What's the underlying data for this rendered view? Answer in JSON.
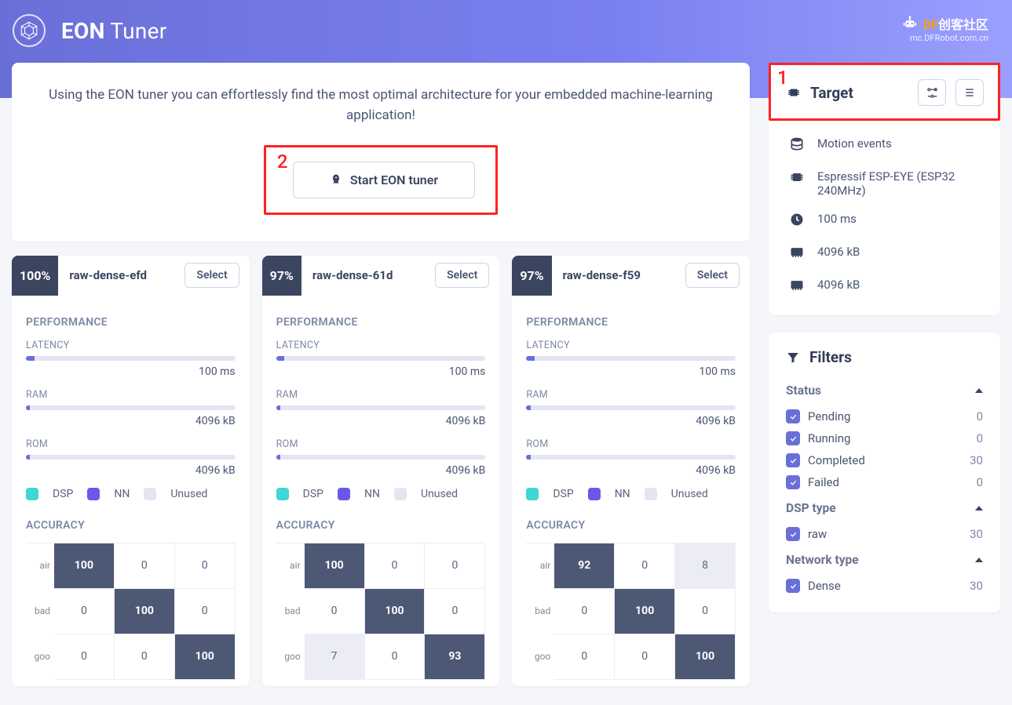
{
  "header": {
    "title_bold": "EON",
    "title_light": "Tuner",
    "watermark_prefix": "DF",
    "watermark_text": "创客社区",
    "watermark_sub": "mc.DFRobot.com.cn"
  },
  "intro": {
    "text": "Using the EON tuner you can effortlessly find the most optimal architecture for your embedded machine-learning application!",
    "button": "Start EON tuner",
    "annotation": "2"
  },
  "models": [
    {
      "score": "100%",
      "name": "raw-dense-efd",
      "select": "Select",
      "perf_title": "PERFORMANCE",
      "latency_label": "LATENCY",
      "latency_val": "100 ms",
      "latency_fill": 4,
      "ram_label": "RAM",
      "ram_val": "4096 kB",
      "ram_fill": 2,
      "rom_label": "ROM",
      "rom_val": "4096 kB",
      "rom_fill": 2,
      "legend": {
        "dsp": "DSP",
        "nn": "NN",
        "unused": "Unused"
      },
      "acc_title": "ACCURACY",
      "cm": {
        "rows": [
          "air",
          "bad",
          "goo"
        ],
        "cells": [
          [
            {
              "v": "100",
              "c": "dk"
            },
            {
              "v": "0",
              "c": ""
            },
            {
              "v": "0",
              "c": ""
            }
          ],
          [
            {
              "v": "0",
              "c": ""
            },
            {
              "v": "100",
              "c": "dk"
            },
            {
              "v": "0",
              "c": ""
            }
          ],
          [
            {
              "v": "0",
              "c": ""
            },
            {
              "v": "0",
              "c": ""
            },
            {
              "v": "100",
              "c": "dk"
            }
          ]
        ]
      }
    },
    {
      "score": "97%",
      "name": "raw-dense-61d",
      "select": "Select",
      "perf_title": "PERFORMANCE",
      "latency_label": "LATENCY",
      "latency_val": "100 ms",
      "latency_fill": 4,
      "ram_label": "RAM",
      "ram_val": "4096 kB",
      "ram_fill": 2,
      "rom_label": "ROM",
      "rom_val": "4096 kB",
      "rom_fill": 2,
      "legend": {
        "dsp": "DSP",
        "nn": "NN",
        "unused": "Unused"
      },
      "acc_title": "ACCURACY",
      "cm": {
        "rows": [
          "air",
          "bad",
          "goo"
        ],
        "cells": [
          [
            {
              "v": "100",
              "c": "dk"
            },
            {
              "v": "0",
              "c": ""
            },
            {
              "v": "0",
              "c": ""
            }
          ],
          [
            {
              "v": "0",
              "c": ""
            },
            {
              "v": "100",
              "c": "dk"
            },
            {
              "v": "0",
              "c": ""
            }
          ],
          [
            {
              "v": "7",
              "c": "lt"
            },
            {
              "v": "0",
              "c": ""
            },
            {
              "v": "93",
              "c": "dk"
            }
          ]
        ]
      }
    },
    {
      "score": "97%",
      "name": "raw-dense-f59",
      "select": "Select",
      "perf_title": "PERFORMANCE",
      "latency_label": "LATENCY",
      "latency_val": "100 ms",
      "latency_fill": 4,
      "ram_label": "RAM",
      "ram_val": "4096 kB",
      "ram_fill": 2,
      "rom_label": "ROM",
      "rom_val": "4096 kB",
      "rom_fill": 2,
      "legend": {
        "dsp": "DSP",
        "nn": "NN",
        "unused": "Unused"
      },
      "acc_title": "ACCURACY",
      "cm": {
        "rows": [
          "air",
          "bad",
          "goo"
        ],
        "cells": [
          [
            {
              "v": "92",
              "c": "dk"
            },
            {
              "v": "0",
              "c": ""
            },
            {
              "v": "8",
              "c": "lt"
            }
          ],
          [
            {
              "v": "0",
              "c": ""
            },
            {
              "v": "100",
              "c": "dk"
            },
            {
              "v": "0",
              "c": ""
            }
          ],
          [
            {
              "v": "0",
              "c": ""
            },
            {
              "v": "0",
              "c": ""
            },
            {
              "v": "100",
              "c": "dk"
            }
          ]
        ]
      }
    }
  ],
  "target": {
    "annotation": "1",
    "title": "Target",
    "items": [
      {
        "icon": "db",
        "text": "Motion events"
      },
      {
        "icon": "chip",
        "text": "Espressif ESP-EYE (ESP32 240MHz)"
      },
      {
        "icon": "clock",
        "text": "100 ms"
      },
      {
        "icon": "mem",
        "text": "4096 kB"
      },
      {
        "icon": "mem",
        "text": "4096 kB"
      }
    ]
  },
  "filters": {
    "title": "Filters",
    "groups": [
      {
        "name": "Status",
        "items": [
          {
            "label": "Pending",
            "count": "0"
          },
          {
            "label": "Running",
            "count": "0"
          },
          {
            "label": "Completed",
            "count": "30"
          },
          {
            "label": "Failed",
            "count": "0"
          }
        ]
      },
      {
        "name": "DSP type",
        "items": [
          {
            "label": "raw",
            "count": "30"
          }
        ]
      },
      {
        "name": "Network type",
        "items": [
          {
            "label": "Dense",
            "count": "30"
          }
        ]
      }
    ]
  }
}
